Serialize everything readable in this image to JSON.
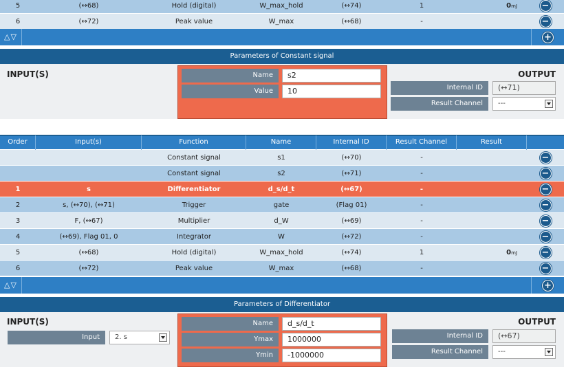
{
  "top_rows": [
    {
      "order": "5",
      "inputs": "(↔68)",
      "function": "Hold (digital)",
      "name": "W_max_hold",
      "internal_id": "(↔74)",
      "channel": "1",
      "result": "0",
      "unit": "mJ"
    },
    {
      "order": "6",
      "inputs": "(↔72)",
      "function": "Peak value",
      "name": "W_max",
      "internal_id": "(↔68)",
      "channel": "-",
      "result": "",
      "unit": ""
    }
  ],
  "toolbar": {
    "arrows": "△▽",
    "add": "+",
    "remove": "−"
  },
  "constant_panel": {
    "title": "Parameters of Constant signal",
    "inputs_label": "INPUT(S)",
    "output_label": "OUTPUT",
    "params": [
      {
        "label": "Name",
        "value": "s2"
      },
      {
        "label": "Value",
        "value": "10"
      }
    ],
    "internal_id_label": "Internal ID",
    "internal_id_value": "(↔71)",
    "result_channel_label": "Result Channel",
    "result_channel_value": "---"
  },
  "table": {
    "headers": [
      "Order",
      "Input(s)",
      "Function",
      "Name",
      "Internal ID",
      "Result Channel",
      "Result"
    ],
    "rows": [
      {
        "order": "",
        "inputs": "",
        "function": "Constant signal",
        "name": "s1",
        "internal_id": "(↔70)",
        "channel": "-",
        "result": "",
        "unit": ""
      },
      {
        "order": "",
        "inputs": "",
        "function": "Constant signal",
        "name": "s2",
        "internal_id": "(↔71)",
        "channel": "-",
        "result": "",
        "unit": ""
      },
      {
        "order": "1",
        "inputs": "s",
        "function": "Differentiator",
        "name": "d_s/d_t",
        "internal_id": "(↔67)",
        "channel": "-",
        "result": "",
        "unit": ""
      },
      {
        "order": "2",
        "inputs": "s, (↔70), (↔71)",
        "function": "Trigger",
        "name": "gate",
        "internal_id": "(Flag 01)",
        "channel": "-",
        "result": "",
        "unit": ""
      },
      {
        "order": "3",
        "inputs": "F, (↔67)",
        "function": "Multiplier",
        "name": "d_W",
        "internal_id": "(↔69)",
        "channel": "-",
        "result": "",
        "unit": ""
      },
      {
        "order": "4",
        "inputs": "(↔69), Flag 01, 0",
        "function": "Integrator",
        "name": "W",
        "internal_id": "(↔72)",
        "channel": "-",
        "result": "",
        "unit": ""
      },
      {
        "order": "5",
        "inputs": "(↔68)",
        "function": "Hold (digital)",
        "name": "W_max_hold",
        "internal_id": "(↔74)",
        "channel": "1",
        "result": "0",
        "unit": "mJ"
      },
      {
        "order": "6",
        "inputs": "(↔72)",
        "function": "Peak value",
        "name": "W_max",
        "internal_id": "(↔68)",
        "channel": "-",
        "result": "",
        "unit": ""
      }
    ]
  },
  "diff_panel": {
    "title": "Parameters of Differentiator",
    "inputs_label": "INPUT(S)",
    "output_label": "OUTPUT",
    "input_label": "Input",
    "input_value": "2. s",
    "params": [
      {
        "label": "Name",
        "value": "d_s/d_t"
      },
      {
        "label": "Ymax",
        "value": "1000000"
      },
      {
        "label": "Ymin",
        "value": "-1000000"
      }
    ],
    "internal_id_label": "Internal ID",
    "internal_id_value": "(↔67)",
    "result_channel_label": "Result Channel",
    "result_channel_value": "---"
  },
  "colors": {
    "accent": "#2e7fc5",
    "dark": "#1b5e92",
    "selected": "#ee6a4c",
    "row_light": "#dde8f1",
    "row_mid": "#a9c9e4"
  }
}
